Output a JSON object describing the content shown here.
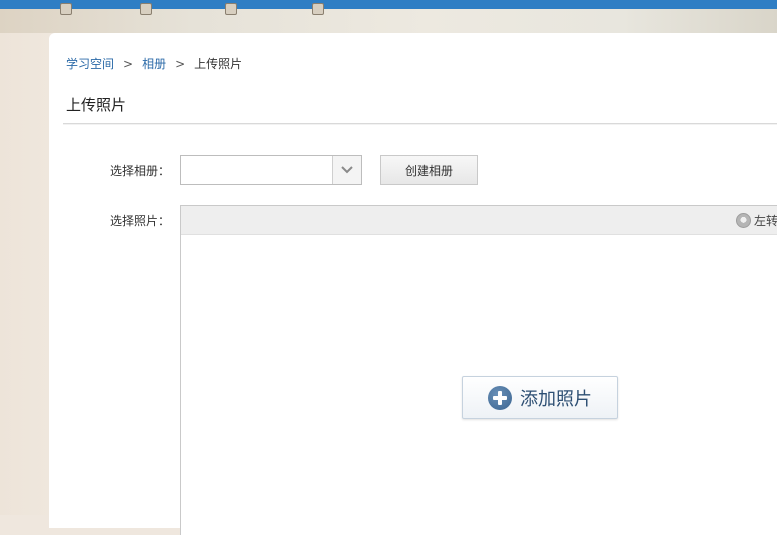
{
  "breadcrumb": {
    "home": "学习空间",
    "sep1": ">",
    "album": "相册",
    "sep2": ">",
    "current": "上传照片"
  },
  "page": {
    "title": "上传照片"
  },
  "form": {
    "select_album_label": "选择相册：",
    "select_album_value": "",
    "create_album_button": "创建相册",
    "select_photo_label": "选择照片："
  },
  "uploader": {
    "rotate_left_label": "左转",
    "add_photo_button": "添加照片"
  },
  "colors": {
    "link": "#2b6aa8",
    "top_strip": "#2f7ec4",
    "add_button_icon": "#3a6490"
  }
}
